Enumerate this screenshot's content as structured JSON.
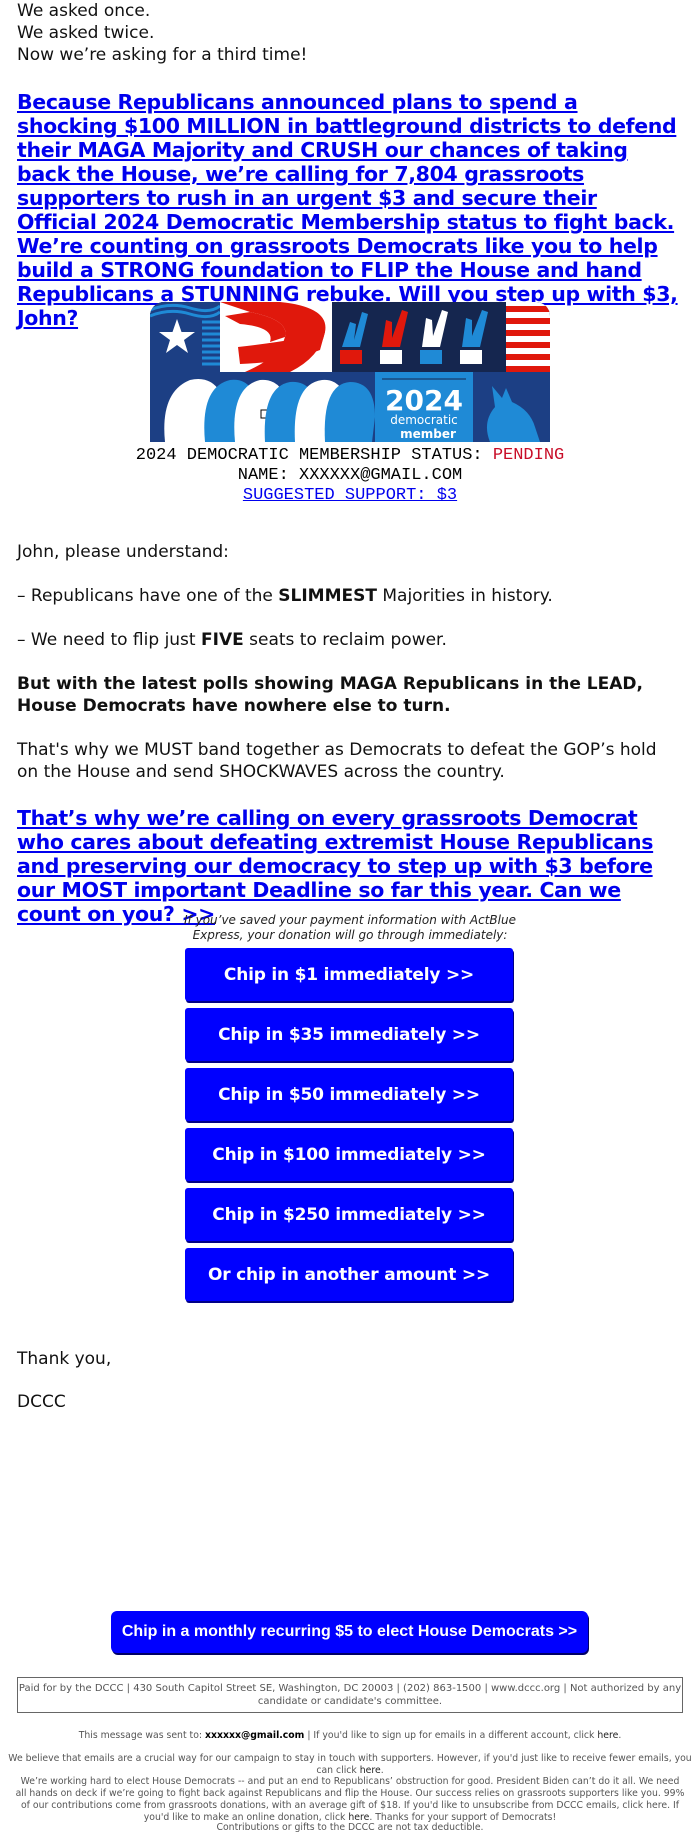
{
  "intro": {
    "line1": "We asked once.",
    "line2": "We asked twice.",
    "line3": "Now we’re asking for a third time!"
  },
  "headline_link": "Because Republicans announced plans to spend a shocking $100 MILLION in battleground districts to defend their MAGA Majority and CRUSH our chances of taking back the House, we’re calling for 7,804 grassroots supporters to rush in an urgent $3 and secure their Official 2024 Democratic Membership status to fight back. We’re counting on grassroots Democrats like you to help build a STRONG foundation to FLIP the House and hand Republicans a STUNNING rebuke. Will you step up with $3, John?",
  "banner": {
    "year": "2024",
    "line1": "democratic",
    "line2": "member",
    "colors": {
      "navy": "#1c3f84",
      "blue": "#1f8ad6",
      "red": "#e0180c",
      "white": "#ffffff",
      "dark": "#15264f"
    }
  },
  "membership": {
    "status_label": "2024 DEMOCRATIC MEMBERSHIP STATUS:",
    "status_value": "PENDING",
    "name_label": "NAME: XXXXXX@GMAIL.COM",
    "suggested": "SUGGESTED SUPPORT: $3"
  },
  "body": {
    "p1": "John, please understand:",
    "p2_pre": "– Republicans have one of the ",
    "p2_bold": "SLIMMEST",
    "p2_post": " Majorities in history.",
    "p3_pre": "– We need to flip just ",
    "p3_bold": "FIVE",
    "p3_post": " seats to reclaim power.",
    "p4": "But with the latest polls showing MAGA Republicans in the LEAD, House Democrats have nowhere else to turn.",
    "p5": "That's why we MUST band together as Democrats to defeat the GOP’s hold on the House and send SHOCKWAVES across the country.",
    "cta_link": "That’s why we’re calling on every grassroots Democrat who cares about defeating extremist House Republicans and preserving our democracy to step up with $3 before our MOST important Deadline so far this year. Can we count on you? >>"
  },
  "express_note": {
    "line1": "If you’ve saved your payment information with ActBlue",
    "line2": "Express, your donation will go through immediately:"
  },
  "donate_buttons": [
    {
      "label": "Chip in $1 immediately >>"
    },
    {
      "label": "Chip in $35 immediately >>"
    },
    {
      "label": "Chip in $50 immediately >>"
    },
    {
      "label": "Chip in $100 immediately >>"
    },
    {
      "label": "Chip in $250 immediately >>"
    },
    {
      "label": "Or chip in another amount >>"
    }
  ],
  "signoff": {
    "thanks": "Thank you,",
    "org": "DCCC"
  },
  "monthly_button": "Chip in a monthly recurring $5 to elect House Democrats >>",
  "disclaimer": "Paid for by the DCCC | 430 South Capitol Street SE, Washington, DC 20003 | (202) 863-1500 | www.dccc.org | Not authorized by any candidate or candidate's committee.",
  "footer": {
    "sent_pre": "This message was sent to: ",
    "sent_email": "xxxxxx@gmail.com",
    "sent_post": " | If you'd like to sign up for emails in a different account, click ",
    "here": "here",
    "period": ".",
    "fewer_pre": "We believe that emails are a crucial way for our campaign to stay in touch with supporters. However, if you'd just like to receive fewer emails, you can click ",
    "long_pre": "We’re working hard to elect House Democrats -- and put an end to Republicans’ obstruction for good. President Biden can’t do it all. We need all hands on deck if we’re going to fight back against Republicans and flip the House. Our success relies on grassroots supporters like you. 99% of our contributions come from grassroots donations, with an average gift of $18. If you'd like to unsubscribe from DCCC emails, click here. If you'd like to make an online donation, click ",
    "long_post": ". Thanks for your support of Democrats!",
    "tax": "Contributions or gifts to the DCCC are not tax deductible."
  }
}
